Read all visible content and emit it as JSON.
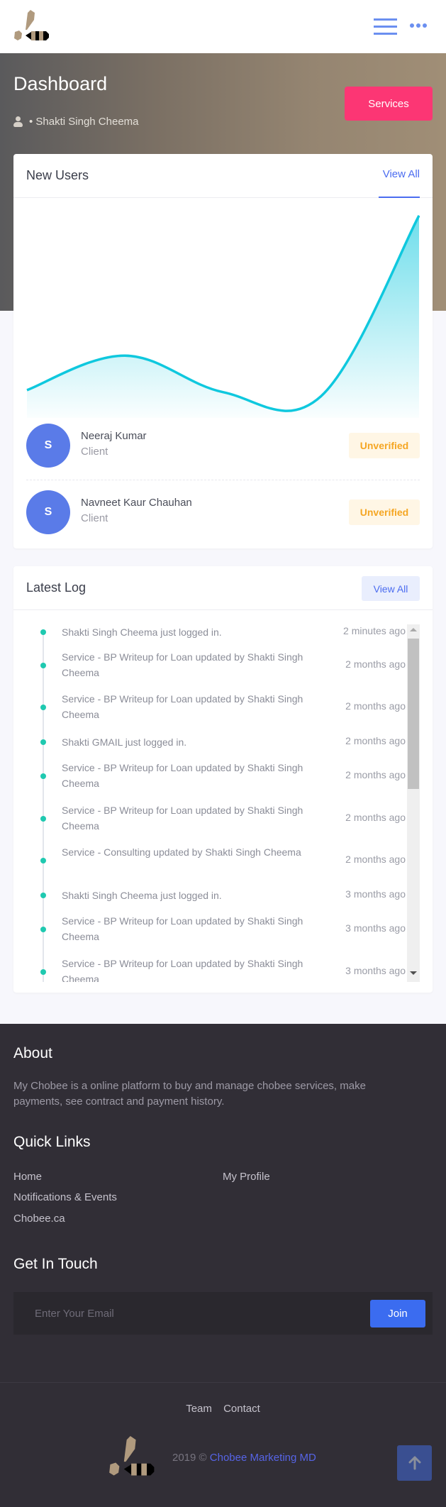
{
  "header": {
    "logo_icon": "chobee-bee-logo",
    "menu_icon": "hamburger-menu-icon",
    "more_icon": "more-dots-icon"
  },
  "hero": {
    "title": "Dashboard",
    "user_prefix": "• ",
    "user_name": "Shakti Singh Cheema",
    "services_button": "Services"
  },
  "new_users": {
    "title": "New Users",
    "view_all": "View All",
    "users": [
      {
        "initial": "S",
        "name": "Neeraj Kumar",
        "role": "Client",
        "status": "Unverified"
      },
      {
        "initial": "S",
        "name": "Navneet Kaur Chauhan",
        "role": "Client",
        "status": "Unverified"
      }
    ]
  },
  "chart_data": {
    "type": "area",
    "title": "",
    "xlabel": "",
    "ylabel": "",
    "x": [
      1,
      2,
      3,
      4,
      5
    ],
    "values": [
      13,
      30,
      12,
      10,
      99
    ],
    "ylim": [
      0,
      100
    ],
    "grid": false,
    "legend": "none",
    "line_color": "#0fc8de"
  },
  "latest_log": {
    "title": "Latest Log",
    "view_all": "View All",
    "items": [
      {
        "text": "Shakti Singh Cheema just logged in.",
        "time": "2 minutes ago"
      },
      {
        "text": "Service - BP Writeup for Loan updated by Shakti Singh Cheema",
        "time": "2 months ago"
      },
      {
        "text": "Service - BP Writeup for Loan updated by Shakti Singh Cheema",
        "time": "2 months ago"
      },
      {
        "text": "Shakti GMAIL just logged in.",
        "time": "2 months ago"
      },
      {
        "text": "Service - BP Writeup for Loan updated by Shakti Singh Cheema",
        "time": "2 months ago"
      },
      {
        "text": "Service - BP Writeup for Loan updated by Shakti Singh Cheema",
        "time": "2 months ago"
      },
      {
        "text": "Service - Consulting updated by Shakti Singh Cheema",
        "time": "2 months ago"
      },
      {
        "text": "Shakti Singh Cheema just logged in.",
        "time": "3 months ago"
      },
      {
        "text": "Service - BP Writeup for Loan updated by Shakti Singh Cheema",
        "time": "3 months ago"
      },
      {
        "text": "Service - BP Writeup for Loan updated by Shakti Singh Cheema",
        "time": "3 months ago"
      }
    ]
  },
  "footer": {
    "about_title": "About",
    "about_text": "My Chobee is a online platform to buy and manage chobee services, make payments, see contract and payment history.",
    "quick_links_title": "Quick Links",
    "quick_links": [
      "Home",
      "My Profile",
      "Notifications & Events",
      "Chobee.ca"
    ],
    "get_in_touch_title": "Get In Touch",
    "email_placeholder": "Enter Your Email",
    "join_button": "Join",
    "bottom_links": [
      "Team",
      "Contact"
    ],
    "copyright": "2019 © ",
    "brand": "Chobee Marketing MD",
    "back_to_top_icon": "arrow-up-icon"
  }
}
